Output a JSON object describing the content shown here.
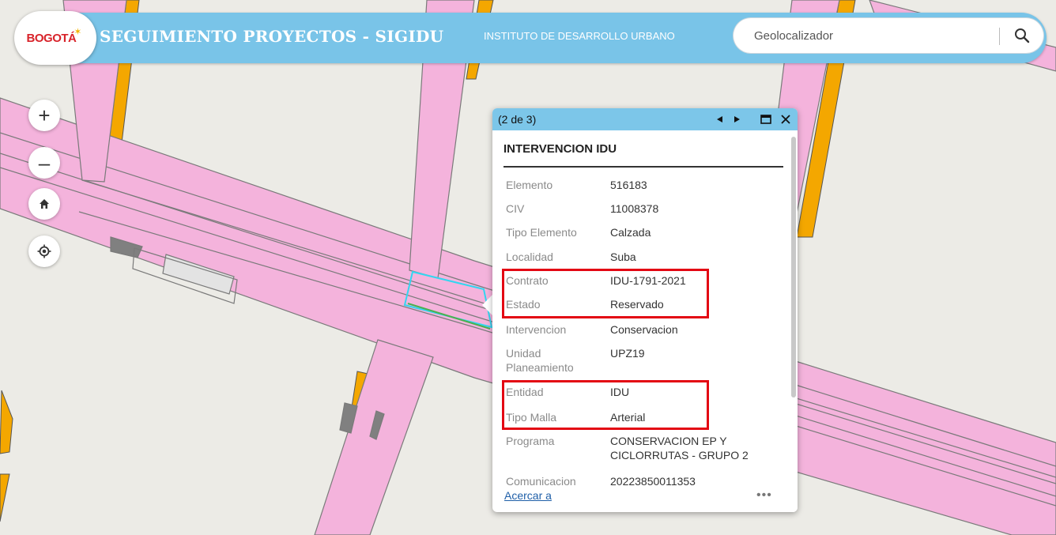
{
  "header": {
    "logo_text": "BOGOTÁ",
    "title": "SEGUIMIENTO PROYECTOS - SIGIDU",
    "subtitle": "INSTITUTO DE DESARROLLO URBANO",
    "search_placeholder": "Geolocalizador",
    "search_icon": "search-icon"
  },
  "map_controls": [
    {
      "name": "zoom-in-button",
      "icon": "plus-icon",
      "glyph": "+"
    },
    {
      "name": "zoom-out-button",
      "icon": "minus-icon",
      "glyph": "–"
    },
    {
      "name": "home-button",
      "icon": "home-icon"
    },
    {
      "name": "locate-button",
      "icon": "locate-icon"
    }
  ],
  "popup": {
    "count": "(2 de 3)",
    "title": "INTERVENCION IDU",
    "fields": [
      {
        "key": "Elemento",
        "value": "516183"
      },
      {
        "key": "CIV",
        "value": "11008378"
      },
      {
        "key": "Tipo Elemento",
        "value": "Calzada"
      },
      {
        "key": "Localidad",
        "value": "Suba"
      },
      {
        "key": "Contrato",
        "value": "IDU-1791-2021"
      },
      {
        "key": "Estado",
        "value": "Reservado"
      },
      {
        "key": "Intervencion",
        "value": "Conservacion"
      },
      {
        "key": "Unidad Planeamiento",
        "value": "UPZ19"
      },
      {
        "key": "Entidad",
        "value": "IDU"
      },
      {
        "key": "Tipo Malla",
        "value": "Arterial"
      },
      {
        "key": "Programa",
        "value": "CONSERVACION EP Y CICLORRUTAS - GRUPO 2"
      },
      {
        "key": "Comunicacion",
        "value": "20223850011353"
      }
    ],
    "zoom_link": "Acercar a",
    "more": "•••"
  },
  "colors": {
    "header": "#79c4e8",
    "popup_header": "#7cc6e9",
    "road": "#f4b3dc",
    "road_edge": "#777777",
    "curb": "#f4a700",
    "background": "#ecebe6",
    "highlight": "#e30613",
    "selection": "#32d6f0"
  }
}
